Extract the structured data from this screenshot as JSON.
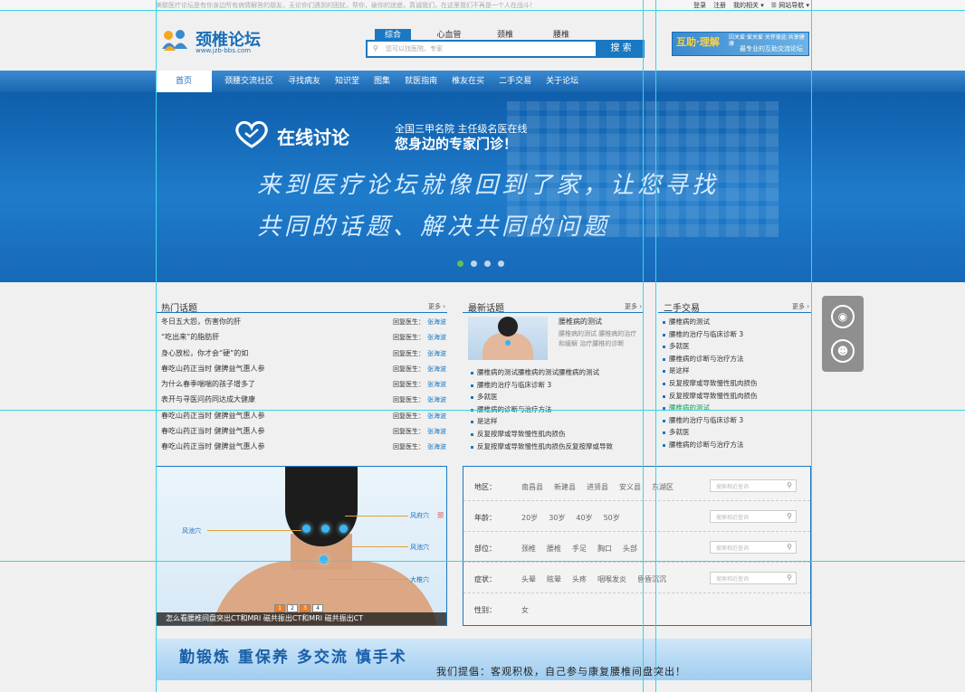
{
  "topbar": {
    "notice": "美联医疗论坛是有你身边所有病情解答的朋友，无论你们遇到的困扰，帮你，破你的迷惑，真诚我们，在这里我们不再是一个人在战斗！",
    "links": [
      "登录",
      "注册",
      "我的相关 ▾",
      "☰ 网站导航 ▾"
    ]
  },
  "header": {
    "logo_text": "颈椎论坛",
    "logo_url": "www.jzb-bbs.com",
    "search_tabs": [
      "综合",
      "心血管",
      "颈椎",
      "腰椎"
    ],
    "search_placeholder": "您可以找医院、专家",
    "search_button": "搜 索",
    "ad_title": "互助·理解",
    "ad_small": "因关爱·爱关爱 关怀彼此·共享健康",
    "ad_bottom": "最专业的互助交流论坛"
  },
  "nav": {
    "items": [
      "首页",
      "颈腰交流社区",
      "寻找病友",
      "知识堂",
      "图集",
      "就医指南",
      "椎友在买",
      "二手交易",
      "关于论坛"
    ]
  },
  "banner": {
    "logo": "在线讨论",
    "sub1": "全国三甲名院  主任级名医在线",
    "sub2": "您身边的专家门诊！",
    "line1": "来到医疗论坛就像回到了家，让您寻找",
    "line2": "共同的话题、解决共同的问题",
    "slides": 4
  },
  "hot": {
    "title": "热门话题",
    "more": "更多 ›",
    "rows": [
      {
        "title": "冬日五大怨，伤害你的肝",
        "reply": "回复医生：",
        "name": "张海波"
      },
      {
        "title": "“吃出来”的脂肪肝",
        "reply": "回复医生：",
        "name": "张海波"
      },
      {
        "title": "身心放松，你才会“硬”的如",
        "reply": "回复医生：",
        "name": "张海波"
      },
      {
        "title": "春吃山药正当时 健脾益气惠人参",
        "reply": "回复医生：",
        "name": "张海波"
      },
      {
        "title": "为什么春季喘喘的孩子增多了",
        "reply": "回复医生：",
        "name": "张海波"
      },
      {
        "title": "表开与寻医问药同达成大健康",
        "reply": "回复医生：",
        "name": "张海波"
      },
      {
        "title": "春吃山药正当时 健脾益气惠人参",
        "reply": "回复医生：",
        "name": "张海波"
      },
      {
        "title": "春吃山药正当时 健脾益气惠人参",
        "reply": "回复医生：",
        "name": "张海波"
      },
      {
        "title": "春吃山药正当时 健脾益气惠人参",
        "reply": "回复医生：",
        "name": "张海波"
      }
    ]
  },
  "latest": {
    "title": "最新话题",
    "more": "更多 ›",
    "feature_title": "腰椎病的测试",
    "feature_desc": "腰椎病的测试 腰椎病的治疗和缓解 治疗腰椎的诊断",
    "items": [
      "腰椎病的测试腰椎病的测试腰椎病的测试",
      "腰椎的治疗与临床诊断 3",
      "多就医",
      "腰椎病的诊断与治疗方法",
      "是这样",
      "反复按摩或导致慢性肌肉损伤",
      "反复按摩或导致慢性肌肉损伤反复按摩或导致"
    ]
  },
  "trade": {
    "title": "二手交易",
    "more": "更多 ›",
    "items": [
      {
        "t": "腰椎病的测试",
        "g": false
      },
      {
        "t": "腰椎的治疗与临床诊断 3",
        "g": false
      },
      {
        "t": "多就医",
        "g": false
      },
      {
        "t": "腰椎病的诊断与治疗方法",
        "g": false
      },
      {
        "t": "是这样",
        "g": false
      },
      {
        "t": "反复按摩或导致慢性肌肉损伤",
        "g": false
      },
      {
        "t": "反复按摩或导致慢性肌肉损伤",
        "g": false
      },
      {
        "t": "腰椎病的测试",
        "g": true
      },
      {
        "t": "腰椎的治疗与临床诊断 3",
        "g": false
      },
      {
        "t": "多就医",
        "g": false
      },
      {
        "t": "腰椎病的诊断与治疗方法",
        "g": false
      }
    ]
  },
  "photo": {
    "labels": [
      "风池穴",
      "风府穴",
      "风池穴",
      "大椎穴"
    ],
    "sides": [
      "颈",
      "",
      "",
      ""
    ],
    "nums": [
      "1",
      "2",
      "3",
      "4"
    ],
    "caption": "怎么看腰椎间盘突出CT和MRI 磁共振出CT和MRI 磁共振出CT"
  },
  "filter": {
    "rows": [
      {
        "label": "地区：",
        "opts": [
          "南昌县",
          "新建县",
          "进贤县",
          "安义县",
          "东湖区"
        ],
        "ph": "搜索相近查询"
      },
      {
        "label": "年龄：",
        "opts": [
          "20岁",
          "30岁",
          "40岁",
          "50岁"
        ],
        "ph": "搜索相近查询"
      },
      {
        "label": "部位：",
        "opts": [
          "颈椎",
          "腰椎",
          "手足",
          "胸口",
          "头部"
        ],
        "ph": "搜索相近查询"
      },
      {
        "label": "症状：",
        "opts": [
          "头晕",
          "眩晕",
          "头疼",
          "咽喉发炎",
          "昏昏沉沉"
        ],
        "ph": "搜索相近查询"
      },
      {
        "label": "性别：",
        "opts": [
          "女"
        ],
        "ph": ""
      }
    ]
  },
  "slogan": {
    "s1": "勤锻炼  重保养  多交流  慎手术",
    "s2": "我们提倡：客观积极，自己参与康复腰椎间盘突出！"
  }
}
